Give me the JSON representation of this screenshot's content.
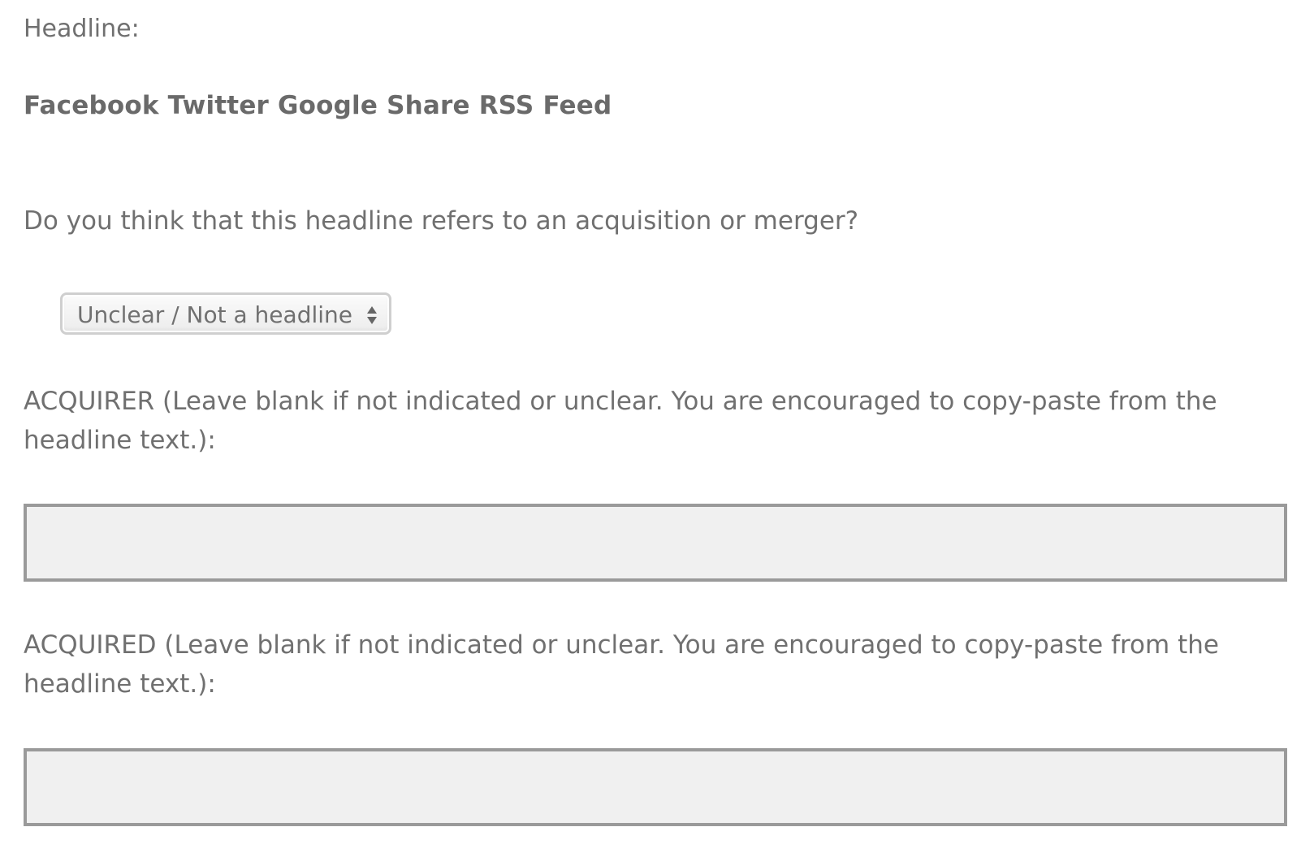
{
  "headline": {
    "label": "Headline:",
    "text": "Facebook Twitter Google Share RSS Feed"
  },
  "question": {
    "text": "Do you think that this headline refers to an acquisition or merger?",
    "selected": "Unclear / Not a headline"
  },
  "acquirer": {
    "label": "ACQUIRER (Leave blank if not indicated or unclear. You are encouraged to copy-paste from the headline text.):",
    "value": ""
  },
  "acquired": {
    "label": "ACQUIRED (Leave blank if not indicated or unclear. You are encouraged to copy-paste from the headline text.):",
    "value": ""
  },
  "colors": {
    "text": "#707070",
    "input_bg": "#f0f0f0",
    "input_border": "#9a9a9a"
  },
  "icons": {
    "select_arrows": "up-down-chevron-icon"
  }
}
